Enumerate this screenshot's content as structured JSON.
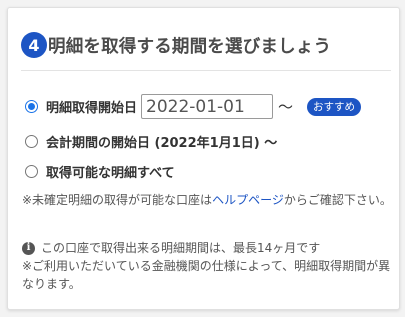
{
  "header": {
    "step_number": "4",
    "title": "明細を取得する期間を選びましょう"
  },
  "options": {
    "opt1_label": "明細取得開始日",
    "date_value": "2022-01-01",
    "tilde": "〜",
    "recommend_badge": "おすすめ",
    "opt2_label": "会計期間の開始日 (2022年1月1日) 〜",
    "opt3_label": "取得可能な明細すべて"
  },
  "notes": {
    "note1_before": "※未確定明細の取得が可能な口座は",
    "note1_link": "ヘルプページ",
    "note1_after": "からご確認下さい。",
    "info_line1": "この口座で取得出来る明細期間は、最長14ヶ月です",
    "info_line2": "※ご利用いただいている金融機関の仕様によって、明細取得期間が異なります。",
    "info_icon_glyph": "i"
  },
  "colors": {
    "accent": "#1d55c4",
    "radio": "#1a73e8"
  },
  "selected_option": "opt1"
}
